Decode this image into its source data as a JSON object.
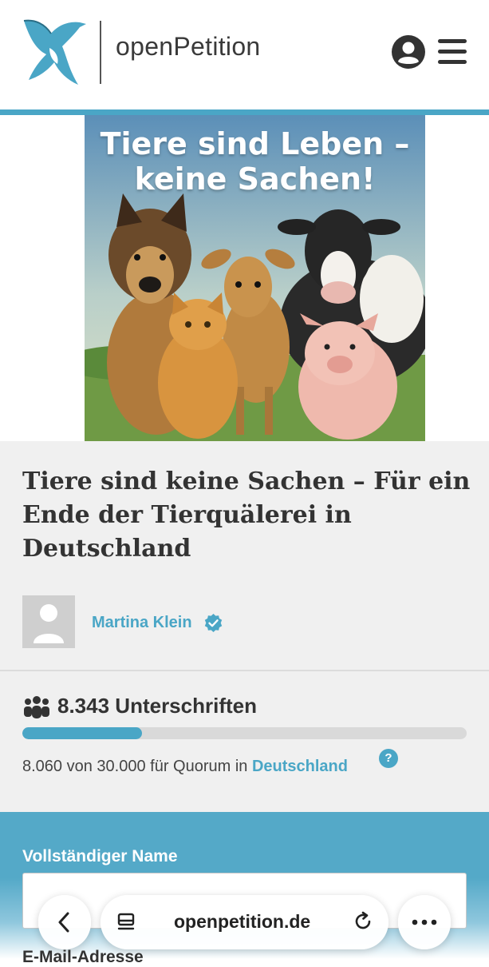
{
  "header": {
    "logo_text": "openPetition",
    "brand_color": "#4aa6c6",
    "icons": [
      "bird-logo-icon",
      "account-icon",
      "hamburger-menu-icon"
    ]
  },
  "hero": {
    "headline": "Tiere sind Leben – keine Sachen!",
    "headline_line1": "Tiere sind Leben –",
    "headline_line2": "keine Sachen!"
  },
  "petition": {
    "title": "Tiere sind keine Sachen – Für ein Ende der Tierquälerei in Deutschland",
    "author": "Martina Klein",
    "signatures": "8.343 Unterschriften",
    "quorum_prefix": "8.060 von 30.000 für Quorum in ",
    "quorum_region": "Deutschland",
    "help": "?",
    "progress_fraction": 0.27
  },
  "form": {
    "name_label": "Vollständiger Name",
    "name_value": "",
    "email_label": "E-Mail-Adresse"
  },
  "browser": {
    "url": "openpetition.de",
    "icons": [
      "back-icon",
      "tabs-icon",
      "reload-icon",
      "more-icon"
    ]
  }
}
